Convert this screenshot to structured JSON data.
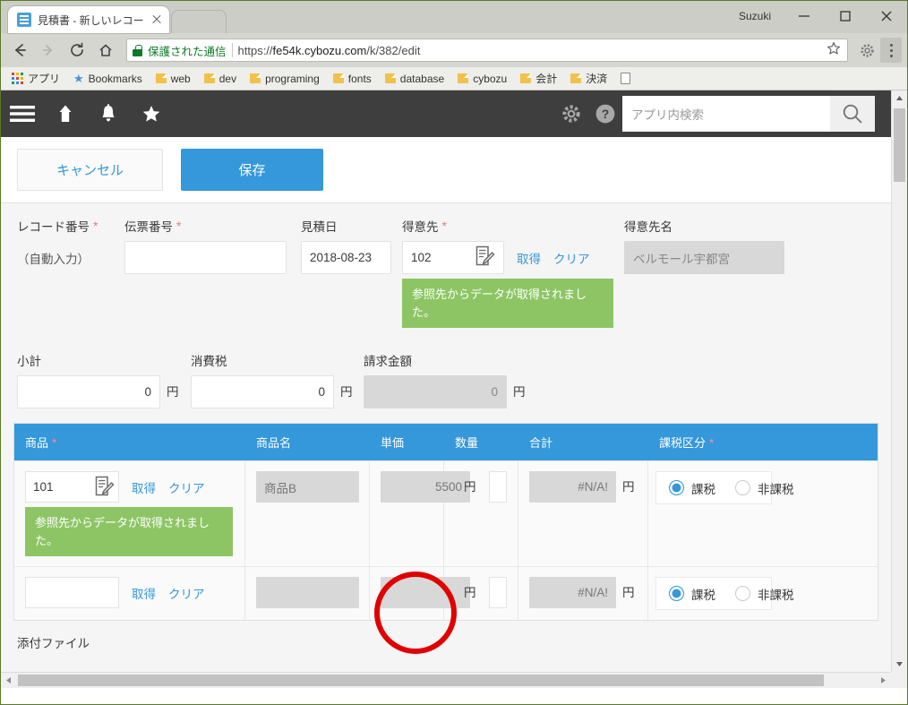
{
  "browser": {
    "tab": {
      "title": "見積書 - 新しいレコード",
      "favicon": "kintone-record-icon",
      "close": "×"
    },
    "window": {
      "user": "Suzuki",
      "minimize": "minimize-icon",
      "maximize": "maximize-icon",
      "close": "close-icon"
    },
    "toolbar": {
      "back": "back-arrow-icon",
      "forward": "forward-arrow-icon",
      "reload": "reload-icon",
      "home": "home-icon",
      "secure_label": "保護された通信",
      "url_scheme": "https://",
      "url_host": "fe54k.cybozu.com",
      "url_path": "/k/382/edit",
      "url_full": "https://fe54k.cybozu.com/k/382/edit",
      "bookmark_star": "star-icon",
      "extension": "extension-gear-icon",
      "menu": "three-dot-menu-icon"
    },
    "bookmarks": [
      {
        "label": "アプリ",
        "icon": "apps-grid-icon"
      },
      {
        "label": "Bookmarks",
        "icon": "star-icon"
      },
      {
        "label": "web",
        "icon": "folder-icon"
      },
      {
        "label": "dev",
        "icon": "folder-icon"
      },
      {
        "label": "programing",
        "icon": "folder-icon"
      },
      {
        "label": "fonts",
        "icon": "folder-icon"
      },
      {
        "label": "database",
        "icon": "folder-icon"
      },
      {
        "label": "cybozu",
        "icon": "folder-icon"
      },
      {
        "label": "会計",
        "icon": "folder-icon"
      },
      {
        "label": "決済",
        "icon": "folder-icon"
      },
      {
        "label": "",
        "icon": "page-icon"
      }
    ]
  },
  "app_header": {
    "menu_icon": "hamburger-menu-icon",
    "home_icon": "home-icon",
    "bell_icon": "bell-notification-icon",
    "star_icon": "star-favorite-icon",
    "gear_icon": "gear-settings-icon",
    "help_icon": "help-question-icon",
    "search_placeholder": "アプリ内検索",
    "search_button": "search-magnifier-icon"
  },
  "actions": {
    "cancel_label": "キャンセル",
    "save_label": "保存"
  },
  "form": {
    "record_number": {
      "label": "レコード番号",
      "required": true,
      "value": "（自動入力）"
    },
    "slip_number": {
      "label": "伝票番号",
      "required": true,
      "value": ""
    },
    "quote_date": {
      "label": "見積日",
      "required": false,
      "value": "2018-08-23"
    },
    "customer": {
      "label": "得意先",
      "required": true,
      "value": "102",
      "icon": "lookup-edit-icon",
      "fetch_label": "取得",
      "clear_label": "クリア",
      "notice": "参照先からデータが取得されました。"
    },
    "customer_name": {
      "label": "得意先名",
      "required": false,
      "value": "ベルモール宇都宮",
      "readonly": true
    },
    "subtotal": {
      "label": "小計",
      "value": "0",
      "unit": "円",
      "readonly": false
    },
    "tax": {
      "label": "消費税",
      "value": "0",
      "unit": "円",
      "readonly": false
    },
    "billing_amount": {
      "label": "請求金額",
      "value": "0",
      "unit": "円",
      "readonly": true
    }
  },
  "table": {
    "columns": [
      {
        "key": "product",
        "label": "商品",
        "required": true
      },
      {
        "key": "product_name",
        "label": "商品名",
        "required": false
      },
      {
        "key": "unit_price",
        "label": "単価",
        "required": false
      },
      {
        "key": "quantity",
        "label": "数量",
        "required": false
      },
      {
        "key": "total",
        "label": "合計",
        "required": false
      },
      {
        "key": "tax_class",
        "label": "課税区分",
        "required": true
      }
    ],
    "fetch_label": "取得",
    "clear_label": "クリア",
    "unit": "円",
    "tax_options": [
      {
        "label": "課税",
        "value": "taxable"
      },
      {
        "label": "非課税",
        "value": "nontaxable"
      }
    ],
    "rows": [
      {
        "product": "101",
        "has_lookup_icon": true,
        "notice": "参照先からデータが取得されました。",
        "product_name": "商品B",
        "unit_price": "5500",
        "quantity": "",
        "total": "#N/A!",
        "tax_selected": "taxable"
      },
      {
        "product": "",
        "has_lookup_icon": false,
        "notice": "",
        "product_name": "",
        "unit_price": "",
        "quantity": "",
        "total": "#N/A!",
        "tax_selected": "taxable"
      }
    ]
  },
  "attachment": {
    "label": "添付ファイル"
  },
  "annotation": {
    "shape": "circle",
    "color": "#e10000",
    "target": "unit-price-row-2"
  },
  "colors": {
    "accent_blue": "#3498db",
    "notice_green": "#8dc565",
    "header_dark": "#3e3e3e",
    "required_red": "#e87b7b",
    "annotation_red": "#e10000"
  }
}
